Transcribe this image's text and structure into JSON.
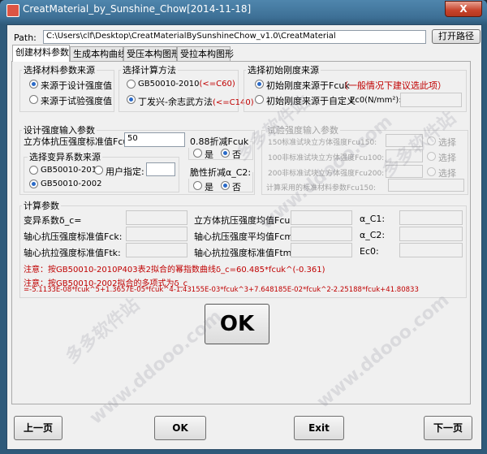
{
  "window": {
    "title": "CreatMaterial_by_Sunshine_Chow[2014-11-18]",
    "close_symbol": "X"
  },
  "path": {
    "label": "Path:",
    "value": "C:\\Users\\clf\\Desktop\\CreatMaterialBySunshineChow_v1.0\\CreatMaterial",
    "open_button": "打开路径"
  },
  "tabs": [
    {
      "label": "创建材料参数",
      "active": true
    },
    {
      "label": "生成本构曲线",
      "active": false
    },
    {
      "label": "受压本构图形",
      "active": false
    },
    {
      "label": "受拉本构图形",
      "active": false
    }
  ],
  "source_group": {
    "title": "选择材料参数来源",
    "options": [
      "来源于设计强度值",
      "来源于试验强度值"
    ],
    "selected": 0
  },
  "method_group": {
    "title": "选择计算方法",
    "options": [
      {
        "main": "GB50010-2010",
        "note": "(<=C60)"
      },
      {
        "main": "丁发兴-余志武方法",
        "note": "(<=C140)"
      }
    ],
    "selected": 1
  },
  "stiffness_group": {
    "title": "选择初始刚度来源",
    "options": [
      "初始刚度来源于Fcuk",
      "初始刚度来源于自定义"
    ],
    "note": "（一般情况下建议选此项）",
    "ec0_label": "Ec0(N/mm²):",
    "ec0_value": "",
    "selected": 0
  },
  "design_group": {
    "title": "设计强度输入参数",
    "fcuk_label": "立方体抗压强度标准值Fcuk:",
    "fcuk_value": "50",
    "reduce_title": "0.88折减Fcuk",
    "reduce_options": [
      "是",
      "否"
    ],
    "reduce_selected": 1,
    "brittle_title": "脆性折减α_C2:",
    "brittle_options": [
      "是",
      "否"
    ],
    "brittle_selected": 1,
    "coef_title": "选择变异系数来源",
    "coef_options": [
      "GB50010-2010",
      "用户指定:",
      "GB50010-2002"
    ],
    "coef_selected": 2,
    "user_value": ""
  },
  "test_group": {
    "title": "试验强度输入参数",
    "rows": [
      "150标准试块立方体强度Fcu150:",
      "100非标准试块立方体强度Fcu100:",
      "200非标准试块立方体强度Fcu200:"
    ],
    "select_label": "选择",
    "adopt_label": "计算采用的标准材料参数Fcu150:"
  },
  "calc_group": {
    "title": "计算参数",
    "col1": [
      "变异系数δ_c=",
      "轴心抗压强度标准值Fck:",
      "轴心抗拉强度标准值Ftk:"
    ],
    "col2": [
      "立方体抗压强度均值Fcum:",
      "轴心抗压强度平均值Fcm:",
      "轴心抗拉强度标准值Ftm:"
    ],
    "col3": [
      "α_C1:",
      "α_C2:",
      "Ec0:"
    ]
  },
  "notes": [
    "注意：按GB50010-2010P403表2拟合的幂指数曲线δ_c=60.485*fcuk^(-0.361)",
    "注意：按GB50010-2002拟合的多项式为δ_c",
    "=-5.1133E-08*fcuk^5+1.3657E-05*fcuk^4-1.43155E-03*fcuk^3+7.648185E-02*fcuk^2-2.25188*fcuk+41.80833"
  ],
  "ok_big": "OK",
  "bottom": {
    "prev": "上一页",
    "ok": "OK",
    "exit": "Exit",
    "next": "下一页"
  },
  "watermarks": [
    "多多软件站",
    "www.ddooo.com",
    "多多软件站",
    "www.ddooo.com",
    "www.ddooo.com",
    "多多软件站"
  ]
}
